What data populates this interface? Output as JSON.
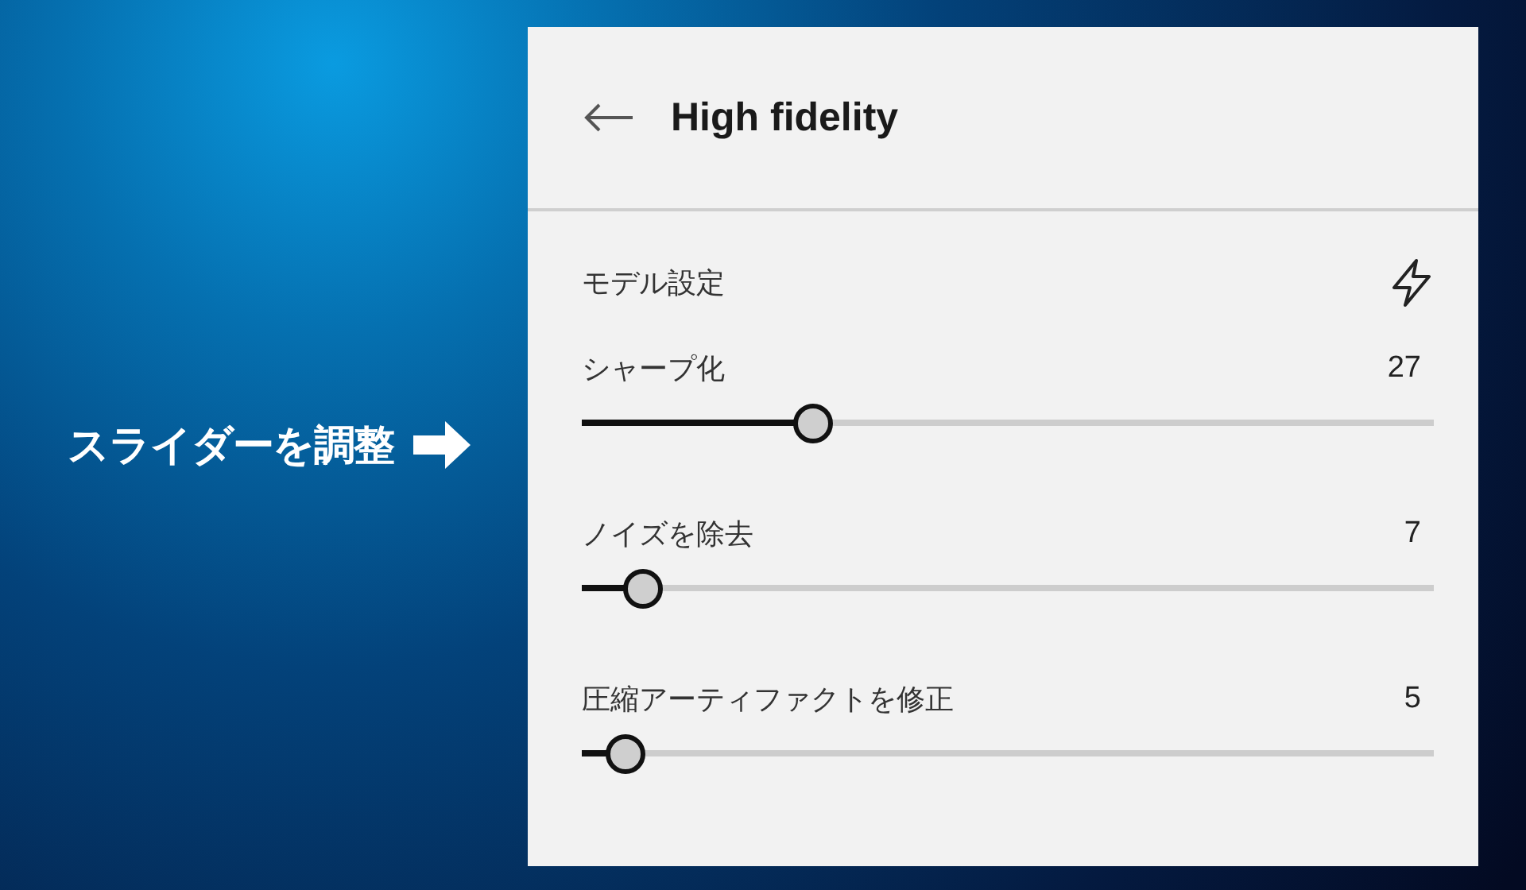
{
  "callout": {
    "text": "スライダーを調整"
  },
  "panel": {
    "title": "High fidelity",
    "section": "モデル設定",
    "sliders": [
      {
        "label": "シャープ化",
        "reading": "27",
        "level": 0.27
      },
      {
        "label": "ノイズを除去",
        "reading": "7",
        "level": 0.07
      },
      {
        "label": "圧縮アーティファクトを修正",
        "reading": "5",
        "level": 0.05
      }
    ]
  }
}
